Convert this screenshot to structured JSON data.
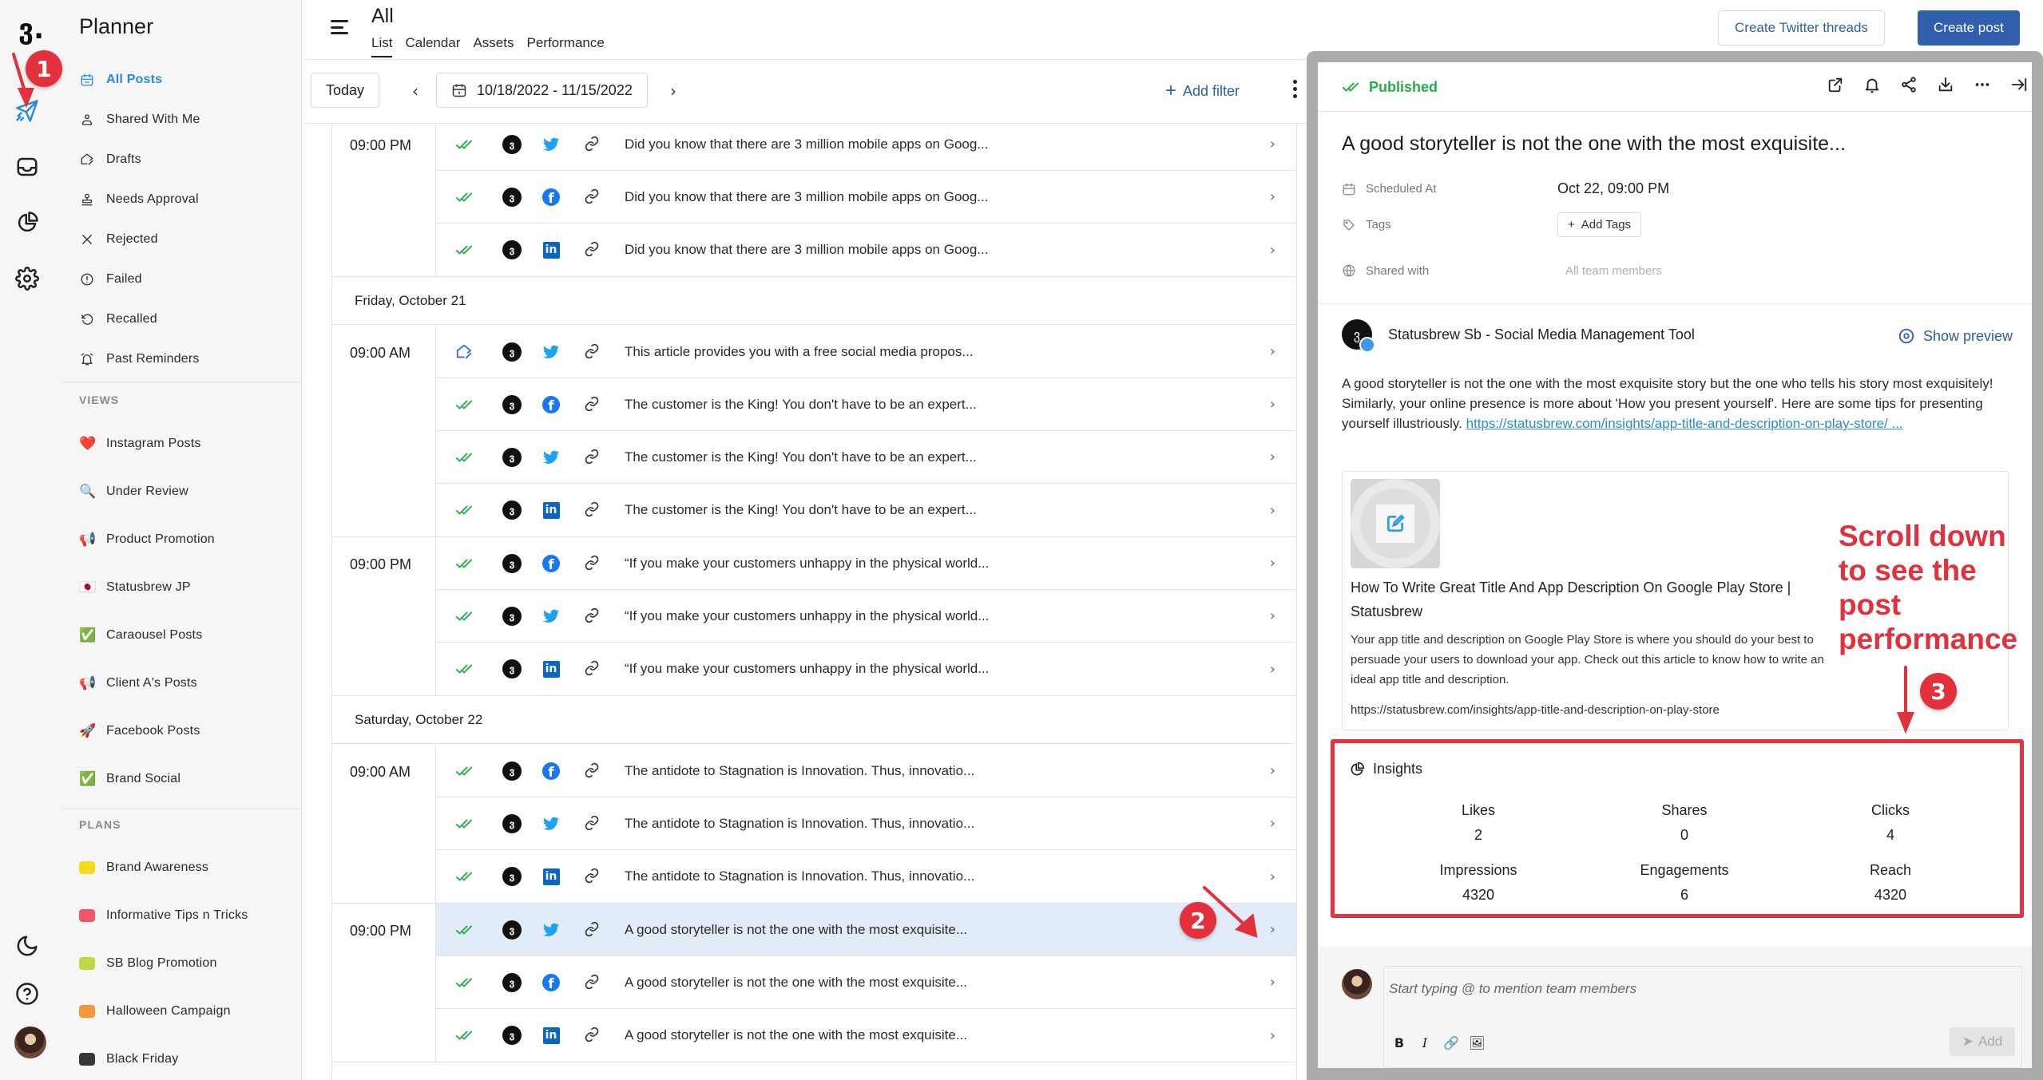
{
  "app": {
    "logo_glyph": "ვ.",
    "rail_icons": [
      "logo-icon",
      "send-icon",
      "inbox-icon",
      "analytics-icon",
      "settings-icon",
      "moon-icon",
      "help-icon",
      "avatar"
    ]
  },
  "sidebar": {
    "title": "Planner",
    "items": [
      {
        "label": "All Posts",
        "icon": "calendar-icon",
        "active": true
      },
      {
        "label": "Shared With Me",
        "icon": "user-icon"
      },
      {
        "label": "Drafts",
        "icon": "draft-icon"
      },
      {
        "label": "Needs Approval",
        "icon": "stamp-icon"
      },
      {
        "label": "Rejected",
        "icon": "x-icon"
      },
      {
        "label": "Failed",
        "icon": "alert-circle-icon"
      },
      {
        "label": "Recalled",
        "icon": "undo-icon"
      },
      {
        "label": "Past Reminders",
        "icon": "alarm-icon"
      }
    ],
    "views_label": "VIEWS",
    "views": [
      {
        "label": "Instagram Posts",
        "emoji": "❤️"
      },
      {
        "label": "Under Review",
        "emoji": "🔍"
      },
      {
        "label": "Product Promotion",
        "emoji": "📢"
      },
      {
        "label": "Statusbrew JP",
        "emoji": "🇯🇵"
      },
      {
        "label": "Caraousel Posts",
        "emoji": "✅"
      },
      {
        "label": "Client A's Posts",
        "emoji": "📢"
      },
      {
        "label": "Facebook Posts",
        "emoji": "🚀"
      },
      {
        "label": "Brand Social",
        "emoji": "✅"
      }
    ],
    "plans_label": "PLANS",
    "plans": [
      {
        "label": "Brand Awareness",
        "color": "#f9d91e"
      },
      {
        "label": "Informative Tips n Tricks",
        "color": "#f0566a"
      },
      {
        "label": "SB Blog Promotion",
        "color": "#bcd843"
      },
      {
        "label": "Halloween Campaign",
        "color": "#f7953a"
      },
      {
        "label": "Black Friday",
        "color": "#383838"
      }
    ]
  },
  "header": {
    "title": "All",
    "tabs": [
      {
        "label": "List",
        "active": true
      },
      {
        "label": "Calendar"
      },
      {
        "label": "Assets"
      },
      {
        "label": "Performance"
      }
    ],
    "create_threads_label": "Create Twitter threads",
    "create_post_label": "Create post"
  },
  "toolbar": {
    "today_label": "Today",
    "prev_glyph": "‹",
    "next_glyph": "›",
    "date_range": "10/18/2022 - 11/15/2022",
    "add_filter_label": "Add filter"
  },
  "list": {
    "groups": [
      {
        "date": null,
        "slots": [
          {
            "time": "09:00 PM",
            "posts": [
              {
                "status": "published",
                "network": "twitter",
                "text": "Did you know that there are 3 million mobile apps on Goog..."
              },
              {
                "status": "published",
                "network": "facebook",
                "text": "Did you know that there are 3 million mobile apps on Goog..."
              },
              {
                "status": "published",
                "network": "linkedin",
                "text": "Did you know that there are 3 million mobile apps on Goog..."
              }
            ]
          }
        ]
      },
      {
        "date": "Friday, October 21",
        "slots": [
          {
            "time": "09:00 AM",
            "posts": [
              {
                "status": "draft",
                "network": "twitter",
                "text": "This article provides you with a free social media propos..."
              },
              {
                "status": "published",
                "network": "facebook",
                "text": "The customer is the King! You don't have to be an expert..."
              },
              {
                "status": "published",
                "network": "twitter",
                "text": "The customer is the King! You don't have to be an expert..."
              },
              {
                "status": "published",
                "network": "linkedin",
                "text": "The customer is the King! You don't have to be an expert..."
              }
            ]
          },
          {
            "time": "09:00 PM",
            "posts": [
              {
                "status": "published",
                "network": "facebook",
                "text": "“If you make your customers unhappy in the physical world..."
              },
              {
                "status": "published",
                "network": "twitter",
                "text": "“If you make your customers unhappy in the physical world..."
              },
              {
                "status": "published",
                "network": "linkedin",
                "text": "“If you make your customers unhappy in the physical world..."
              }
            ]
          }
        ]
      },
      {
        "date": "Saturday, October 22",
        "slots": [
          {
            "time": "09:00 AM",
            "posts": [
              {
                "status": "published",
                "network": "facebook",
                "text": "The antidote to Stagnation is Innovation. Thus, innovatio..."
              },
              {
                "status": "published",
                "network": "twitter",
                "text": "The antidote to Stagnation is Innovation. Thus, innovatio..."
              },
              {
                "status": "published",
                "network": "linkedin",
                "text": "The antidote to Stagnation is Innovation. Thus, innovatio..."
              }
            ]
          },
          {
            "time": "09:00 PM",
            "posts": [
              {
                "status": "published",
                "network": "twitter",
                "text": "A good storyteller is not the one with the most exquisite...",
                "selected": true
              },
              {
                "status": "published",
                "network": "facebook",
                "text": "A good storyteller is not the one with the most exquisite..."
              },
              {
                "status": "published",
                "network": "linkedin",
                "text": "A good storyteller is not the one with the most exquisite..."
              }
            ]
          }
        ]
      }
    ]
  },
  "panel": {
    "status_label": "Published",
    "status_color": "#27ae4a",
    "actions": [
      "open-external-icon",
      "bell-icon",
      "share-icon",
      "download-icon",
      "more-icon",
      "collapse-panel-icon"
    ],
    "title": "A good storyteller is not the one with the most exquisite...",
    "scheduled_label": "Scheduled At",
    "scheduled_value": "Oct 22, 09:00 PM",
    "tags_label": "Tags",
    "add_tags_label": "Add Tags",
    "shared_label": "Shared with",
    "shared_value": "All team members",
    "account_name": "Statusbrew Sb - Social Media Management Tool",
    "show_preview_label": "Show preview",
    "body_text": "A good storyteller is not the one with the most exquisite story but the one who tells his story most exquisitely! Similarly, your online presence is more about 'How you present yourself'. Here are some tips for presenting yourself illustriously. ",
    "body_link": "https://statusbrew.com/insights/app-title-and-description-on-play-store/ ...",
    "link_card": {
      "title": "How To Write Great Title And App Description On Google Play Store | Statusbrew",
      "description": "Your app title and description on Google Play Store is where you should do your best to persuade your users to download your app. Check out this article to know how to write an ideal app title and description.",
      "url": "https://statusbrew.com/insights/app-title-and-description-on-play-store"
    },
    "insights": {
      "title": "Insights",
      "metrics": [
        {
          "label": "Likes",
          "value": "2"
        },
        {
          "label": "Shares",
          "value": "0"
        },
        {
          "label": "Clicks",
          "value": "4"
        },
        {
          "label": "Impressions",
          "value": "4320"
        },
        {
          "label": "Engagements",
          "value": "6"
        },
        {
          "label": "Reach",
          "value": "4320"
        }
      ]
    },
    "comment": {
      "placeholder": "Start typing @ to mention team members",
      "tools": [
        "B",
        "I",
        "🔗",
        "🖼"
      ],
      "add_label": "Add"
    }
  },
  "annotations": {
    "badge_1": "1",
    "badge_2": "2",
    "badge_3": "3",
    "callout_text": "Scroll down to see the post performance",
    "color": "#e3303d"
  }
}
